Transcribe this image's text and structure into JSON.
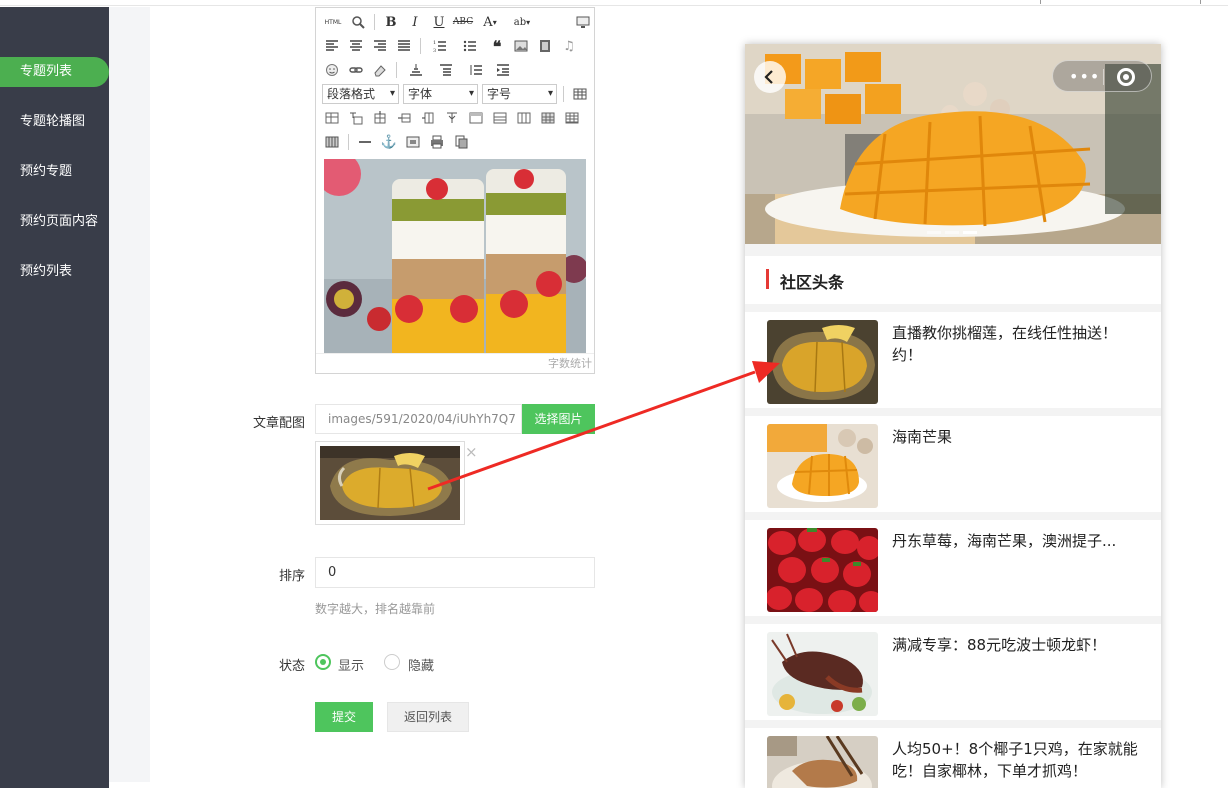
{
  "sidebar": {
    "items": [
      {
        "label": "专题列表",
        "active": true
      },
      {
        "label": "专题轮播图",
        "active": false
      },
      {
        "label": "预约专题",
        "active": false
      },
      {
        "label": "预约页面内容",
        "active": false
      },
      {
        "label": "预约列表",
        "active": false
      }
    ]
  },
  "editor": {
    "toolbar": {
      "html_label": "HTML",
      "paragraph_select": "段落格式",
      "font_select": "字体",
      "size_select": "字号"
    },
    "word_count": "字数统计"
  },
  "form": {
    "image_label": "文章配图",
    "image_path": "images/591/2020/04/iUhYh7Q7",
    "choose_image_button": "选择图片",
    "order_label": "排序",
    "order_value": "0",
    "order_hint": "数字越大，排名越靠前",
    "status_label": "状态",
    "status_options": [
      {
        "label": "显示",
        "selected": true
      },
      {
        "label": "隐藏",
        "selected": false
      }
    ],
    "submit_button": "提交",
    "back_button": "返回列表",
    "close_icon": "×"
  },
  "phone": {
    "section_title": "社区头条",
    "capsule_dots": "•••",
    "news": [
      {
        "title": "直播教你挑榴莲，在线任性抽送！约！",
        "image": "durian"
      },
      {
        "title": "海南芒果",
        "image": "mango"
      },
      {
        "title": "丹东草莓，海南芒果，澳洲提子...",
        "image": "strawberry"
      },
      {
        "title": "满减专享：88元吃波士顿龙虾！",
        "image": "lobster"
      },
      {
        "title": "人均50+！8个椰子1只鸡，在家就能吃！自家椰林，下单才抓鸡！",
        "image": "chicken"
      }
    ]
  },
  "colors": {
    "sidebar_bg": "#393d49",
    "accent_green": "#4ec55d",
    "arrow_red": "#ee2a24",
    "section_bar_red": "#e53935"
  }
}
